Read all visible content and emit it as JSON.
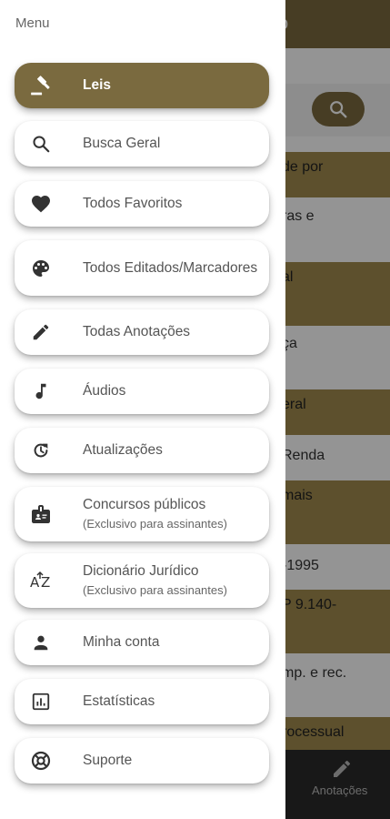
{
  "drawer": {
    "title": "Menu",
    "items": [
      {
        "id": "leis",
        "label": "Leis",
        "icon": "gavel-icon",
        "active": true
      },
      {
        "id": "busca-geral",
        "label": "Busca Geral",
        "icon": "search-icon"
      },
      {
        "id": "todos-favoritos",
        "label": "Todos Favoritos",
        "icon": "heart-icon"
      },
      {
        "id": "todos-editados",
        "label": "Todos Editados/Marcadores",
        "icon": "palette-icon"
      },
      {
        "id": "todas-anotacoes",
        "label": "Todas Anotações",
        "icon": "pencil-icon"
      },
      {
        "id": "audios",
        "label": "Áudios",
        "icon": "music-note-icon"
      },
      {
        "id": "atualizacoes",
        "label": "Atualizações",
        "icon": "update-icon"
      },
      {
        "id": "concursos",
        "label": "Concursos públicos",
        "sub": "(Exclusivo para assinantes)",
        "icon": "badge-icon"
      },
      {
        "id": "dicionario",
        "label": "Dicionário Jurídico",
        "sub": "(Exclusivo para assinantes)",
        "icon": "sort-az-icon"
      },
      {
        "id": "minha-conta",
        "label": "Minha conta",
        "icon": "person-icon"
      },
      {
        "id": "estatisticas",
        "label": "Estatísticas",
        "icon": "bar-chart-icon"
      },
      {
        "id": "suporte",
        "label": "Suporte",
        "icon": "lifebuoy-icon"
      }
    ]
  },
  "background": {
    "topbar_title": "o",
    "list_fragments": [
      "de por",
      "ras e",
      "al",
      "ça",
      "eral",
      "Renda",
      "mais",
      "-1995",
      "P 9.140-",
      "mp. e rec.",
      "rocessual"
    ],
    "bottom_nav_label": "Anotações"
  },
  "colors": {
    "accent": "#7a6a3f",
    "accent_light": "#a08b4e"
  }
}
